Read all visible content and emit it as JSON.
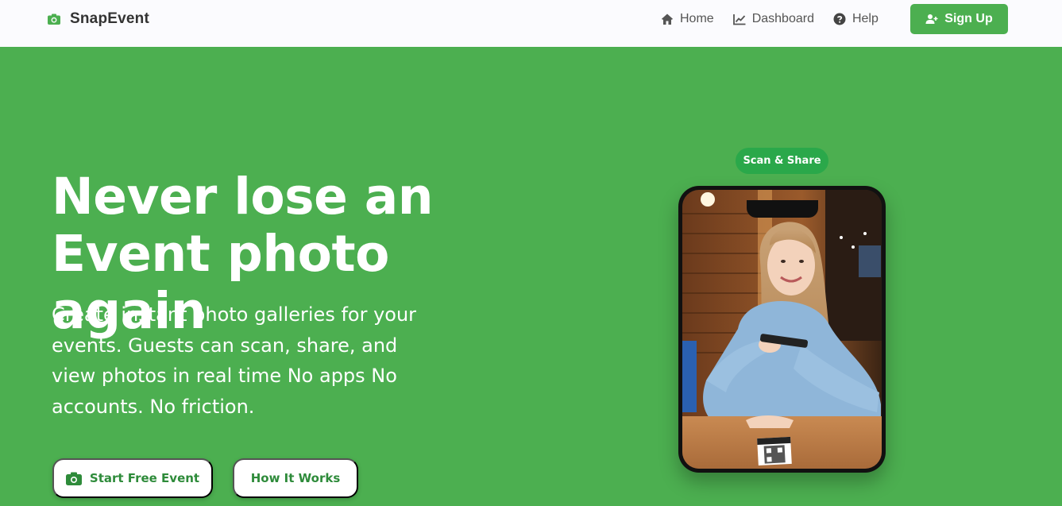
{
  "brand": {
    "name": "SnapEvent",
    "icon": "camera-icon"
  },
  "nav": {
    "items": [
      {
        "label": "Home",
        "icon": "home-icon"
      },
      {
        "label": "Dashboard",
        "icon": "chart-icon"
      },
      {
        "label": "Help",
        "icon": "question-circle-icon"
      }
    ],
    "signup_label": "Sign Up",
    "signup_icon": "user-plus-icon"
  },
  "hero": {
    "title_line1": "Never lose an",
    "title_line2": "Event photo again",
    "subtitle": "Create instant photo galleries for your events. Guests can scan, share, and view photos in real time No apps No accounts. No friction.",
    "primary_cta": "Start Free Event",
    "secondary_cta": "How It Works"
  },
  "phone": {
    "badge": "Scan & Share"
  },
  "colors": {
    "accent": "#4caf50",
    "navbar_bg": "#fbfbfe",
    "badge": "#2aa84a",
    "cta_text": "#2e8b3a"
  }
}
